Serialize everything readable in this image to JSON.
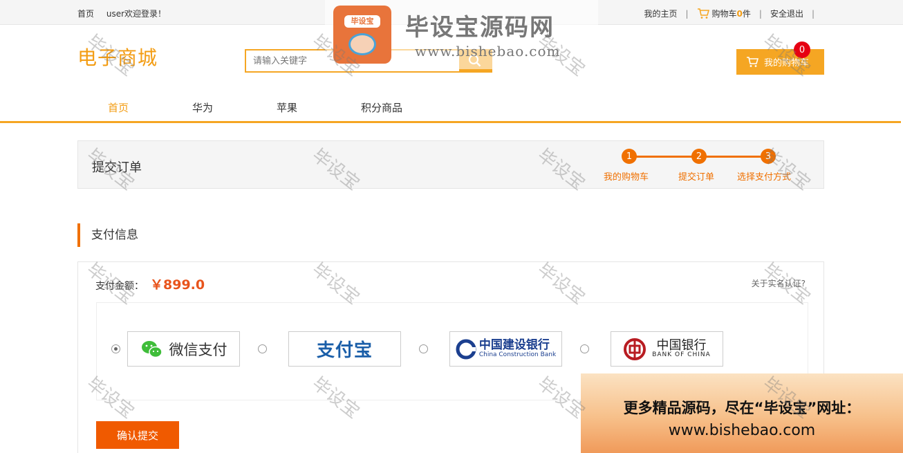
{
  "topbar": {
    "home": "首页",
    "welcome": "user欢迎登录！",
    "my_home": "我的主页",
    "cart_prefix": "购物车",
    "cart_count": "0",
    "cart_suffix": "件",
    "logout": "安全退出"
  },
  "header": {
    "logo": "电子商城",
    "search_placeholder": "请输入关键字",
    "my_cart": "我的购物车",
    "cart_badge": "0"
  },
  "nav": {
    "items": [
      "首页",
      "华为",
      "苹果",
      "积分商品"
    ],
    "active": "首页"
  },
  "order": {
    "title": "提交订单",
    "steps": [
      {
        "num": "1",
        "label": "我的购物车"
      },
      {
        "num": "2",
        "label": "提交订单"
      },
      {
        "num": "3",
        "label": "选择支付方式"
      }
    ]
  },
  "payment": {
    "section_title": "支付信息",
    "amount_label": "支付金额：",
    "amount_value": "￥899.0",
    "realname_link": "关于实名认证?",
    "methods": [
      {
        "name": "微信支付",
        "checked": true
      },
      {
        "name": "支付宝",
        "checked": false
      },
      {
        "name": "中国建设银行",
        "sub": "China Construction Bank",
        "checked": false
      },
      {
        "name": "中国银行",
        "sub": "BANK OF CHINA",
        "checked": false
      }
    ],
    "submit": "确认提交"
  },
  "watermark": {
    "brand": "毕设宝源码网",
    "badge": "毕设宝",
    "url": "www.bishebao.com",
    "stamp": "毕设宝",
    "promo_line1": "更多精品源码，尽在“毕设宝”网址：",
    "promo_line2": "www.bishebao.com"
  },
  "colors": {
    "accent": "#f5a623",
    "orange_dark": "#f07000",
    "price": "#e8541c",
    "badge": "#e60012"
  }
}
